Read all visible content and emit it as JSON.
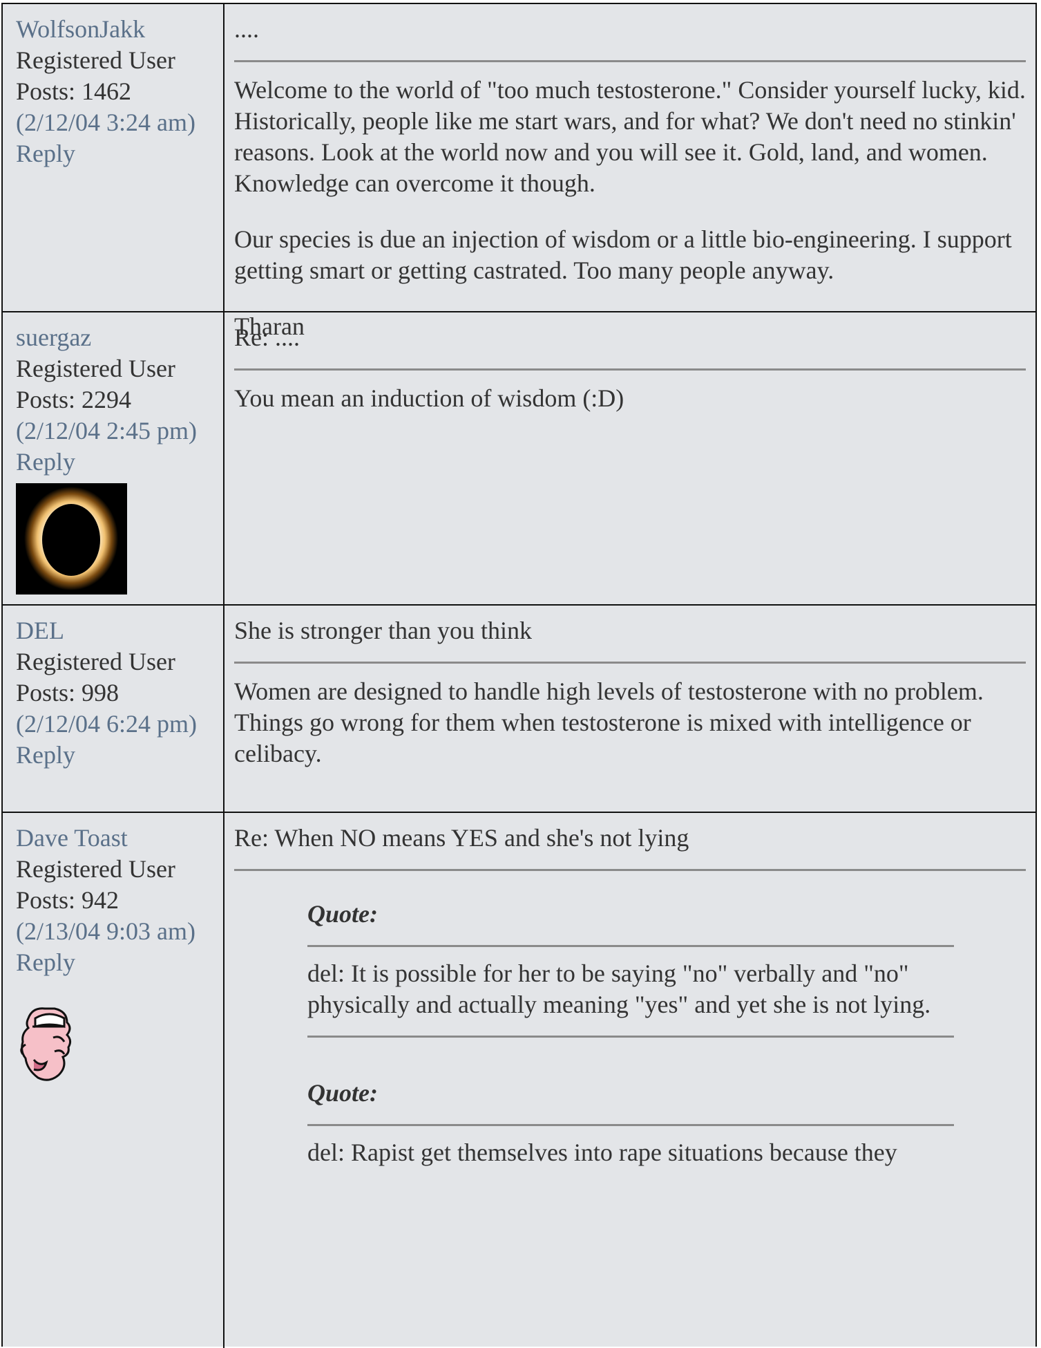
{
  "posts": [
    {
      "author": "WolfsonJakk",
      "role": "Registered User",
      "posts": "Posts: 1462",
      "date": "(2/12/04 3:24 am)",
      "reply": "Reply",
      "subject": "....",
      "paragraphs": [
        "Welcome to the world of \"too much testosterone.\" Consider yourself lucky, kid. Historically, people like me start wars, and for what? We don't need no stinkin' reasons. Look at the world now and you will see it. Gold, land, and women. Knowledge can overcome it though.",
        "Our species is due an injection of wisdom or a little bio-engineering. I support getting smart or getting castrated. Too many people anyway.",
        "Tharan"
      ]
    },
    {
      "author": "suergaz",
      "role": "Registered User",
      "posts": "Posts: 2294",
      "date": "(2/12/04 2:45 pm)",
      "reply": "Reply",
      "avatar": "eclipse-avatar",
      "subject": "Re: ....",
      "paragraphs": [
        "You mean an induction of wisdom (:D)"
      ]
    },
    {
      "author": "DEL",
      "role": "Registered User",
      "posts": "Posts: 998",
      "date": "(2/12/04 6:24 pm)",
      "reply": "Reply",
      "subject": "She is stronger than you think",
      "paragraphs": [
        "Women are designed to handle high levels of testosterone with no problem. Things go wrong for them when testosterone is mixed with intelligence or celibacy."
      ]
    },
    {
      "author": "Dave Toast",
      "role": "Registered User",
      "posts": "Posts: 942",
      "date": "(2/13/04 9:03 am)",
      "reply": "Reply",
      "avatar": "cartoon-face-avatar",
      "subject": "Re: When NO means YES and she's not lying",
      "quotes": [
        {
          "label": "Quote:",
          "text": "del: It is possible for her to be saying \"no\" verbally and \"no\" physically and actually meaning \"yes\" and yet she is not lying."
        },
        {
          "label": "Quote:",
          "text": "del: Rapist get themselves into rape situations because they"
        }
      ]
    }
  ],
  "colors": {
    "background": "#e3e5e8",
    "link": "#5a7089",
    "text": "#333333",
    "border": "#111111"
  }
}
